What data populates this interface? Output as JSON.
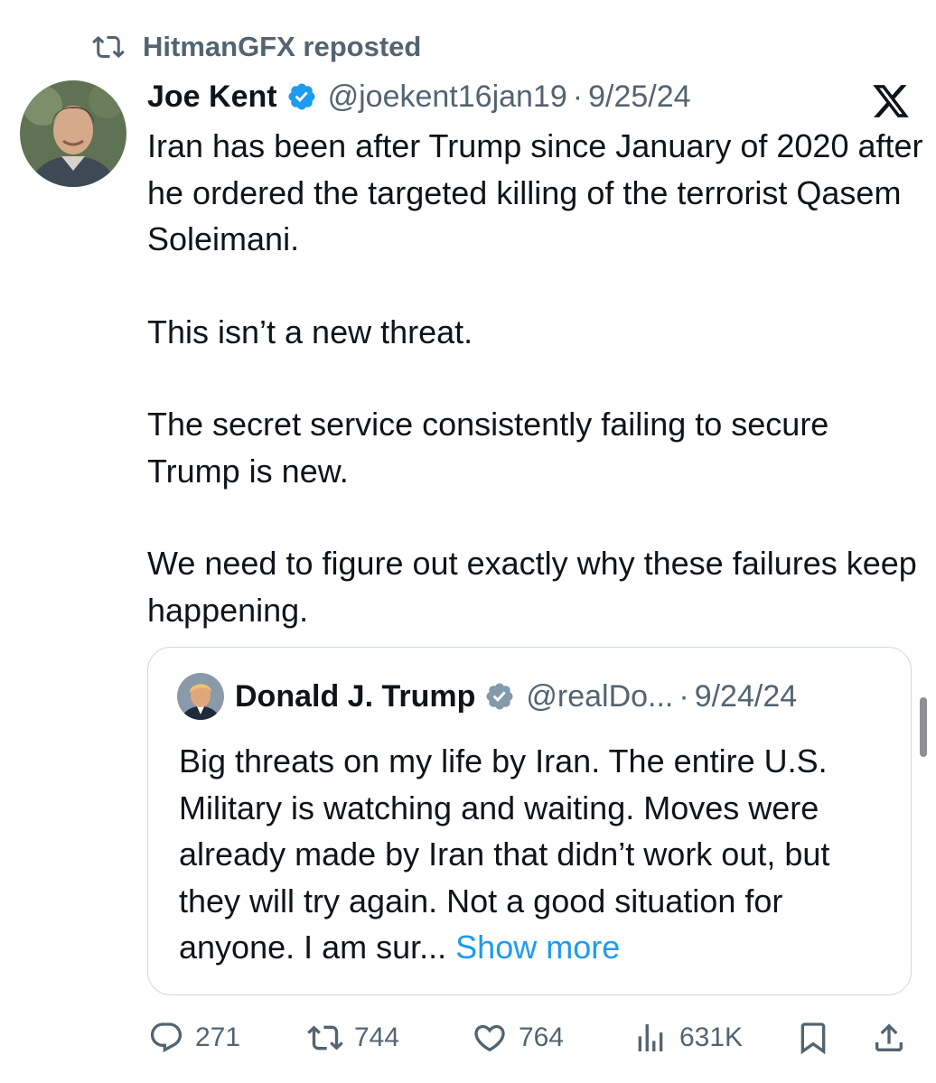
{
  "repost": {
    "text": "HitmanGFX reposted"
  },
  "post": {
    "author_name": "Joe Kent",
    "author_handle": "@joekent16jan19",
    "separator": "·",
    "date": "9/25/24",
    "paragraphs": [
      "Iran has been after Trump since January of 2020 after he ordered the targeted killing of the terrorist Qasem Soleimani.",
      "This isn’t a new threat.",
      "The secret service consistently failing to secure Trump is new.",
      "We need to figure out exactly why these failures keep happening."
    ]
  },
  "quote": {
    "author_name": "Donald J. Trump",
    "author_handle": "@realDo...",
    "separator": "·",
    "date": "9/24/24",
    "text": "Big threats on my life by Iran. The entire U.S. Military is watching and waiting. Moves were already made by Iran that didn’t work out, but they will try again. Not a good situation for anyone. I am sur...",
    "show_more": "Show more"
  },
  "actions": {
    "replies": "271",
    "reposts": "744",
    "likes": "764",
    "views": "631K"
  },
  "icons": {
    "repost": "repost-icon",
    "verified": "verified-badge-icon",
    "brand": "x-logo-icon",
    "reply": "reply-icon",
    "like": "heart-icon",
    "views": "views-icon",
    "bookmark": "bookmark-icon",
    "share": "share-icon"
  },
  "colors": {
    "verified": "#1d9bf0",
    "link": "#1d9bf0",
    "secondary_text": "#536471",
    "quote_verified": "#829aab"
  }
}
